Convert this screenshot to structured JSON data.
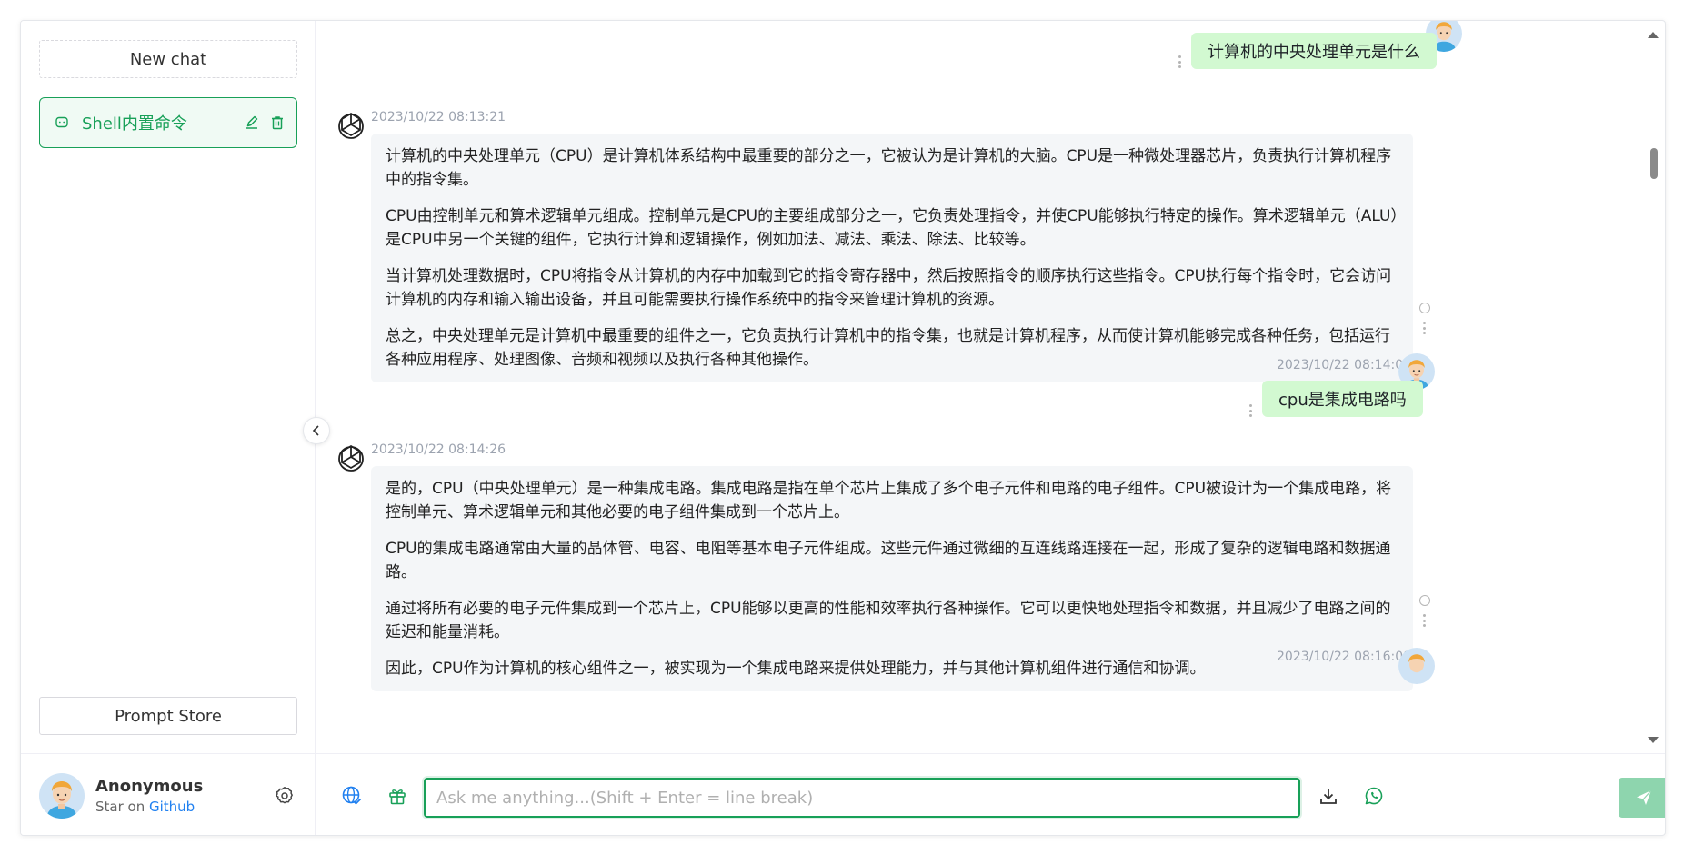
{
  "sidebar": {
    "new_chat_label": "New chat",
    "history": [
      {
        "title": "Shell内置命令",
        "active": true
      }
    ],
    "prompt_store_label": "Prompt Store",
    "user": {
      "name": "Anonymous",
      "desc_prefix": "Star on",
      "desc_link": "Github"
    }
  },
  "chat": {
    "messages": [
      {
        "role": "user",
        "text": "计算机的中央处理单元是什么"
      },
      {
        "role": "assistant",
        "timestamp": "2023/10/22 08:13:21",
        "paragraphs": [
          "计算机的中央处理单元（CPU）是计算机体系结构中最重要的部分之一，它被认为是计算机的大脑。CPU是一种微处理器芯片，负责执行计算机程序中的指令集。",
          "CPU由控制单元和算术逻辑单元组成。控制单元是CPU的主要组成部分之一，它负责处理指令，并使CPU能够执行特定的操作。算术逻辑单元（ALU）是CPU中另一个关键的组件，它执行计算和逻辑操作，例如加法、减法、乘法、除法、比较等。",
          "当计算机处理数据时，CPU将指令从计算机的内存中加载到它的指令寄存器中，然后按照指令的顺序执行这些指令。CPU执行每个指令时，它会访问计算机的内存和输入输出设备，并且可能需要执行操作系统中的指令来管理计算机的资源。",
          "总之，中央处理单元是计算机中最重要的组件之一，它负责执行计算机中的指令集，也就是计算机程序，从而使计算机能够完成各种任务，包括运行各种应用程序、处理图像、音频和视频以及执行各种其他操作。"
        ]
      },
      {
        "role": "user",
        "timestamp": "2023/10/22 08:14:07",
        "text": "cpu是集成电路吗"
      },
      {
        "role": "assistant",
        "timestamp": "2023/10/22 08:14:26",
        "paragraphs": [
          "是的，CPU（中央处理单元）是一种集成电路。集成电路是指在单个芯片上集成了多个电子元件和电路的电子组件。CPU被设计为一个集成电路，将控制单元、算术逻辑单元和其他必要的电子组件集成到一个芯片上。",
          "CPU的集成电路通常由大量的晶体管、电容、电阻等基本电子元件组成。这些元件通过微细的互连线路连接在一起，形成了复杂的逻辑电路和数据通路。",
          "通过将所有必要的电子元件集成到一个芯片上，CPU能够以更高的性能和效率执行各种操作。它可以更快地处理指令和数据，并且减少了电路之间的延迟和能量消耗。",
          "因此，CPU作为计算机的核心组件之一，被实现为一个集成电路来提供处理能力，并与其他计算机组件进行通信和协调。"
        ]
      },
      {
        "role": "user",
        "timestamp": "2023/10/22 08:16:08"
      }
    ]
  },
  "input": {
    "placeholder": "Ask me anything...(Shift + Enter = line break)",
    "value": ""
  },
  "colors": {
    "accent": "#18a058",
    "user_bubble": "#d2f9d1",
    "bot_bubble": "#f4f6f8",
    "link": "#2080f0"
  },
  "icons": {
    "globe": "globe-check-icon",
    "gift": "gift-icon",
    "download": "download-icon",
    "whatsapp": "whatsapp-icon",
    "send": "send-icon",
    "settings": "gear-icon"
  }
}
